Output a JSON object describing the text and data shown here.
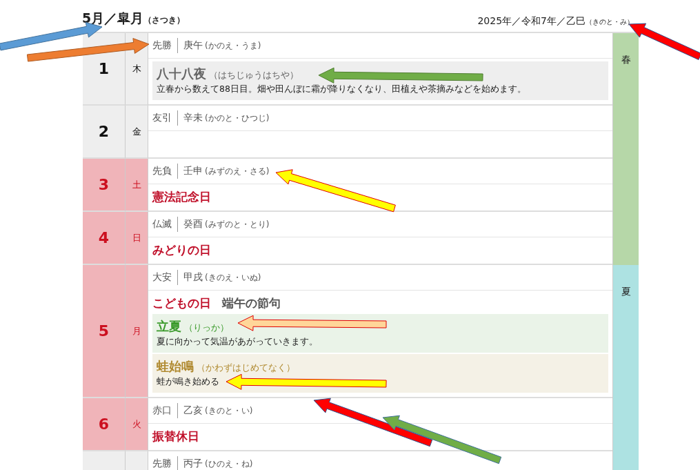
{
  "header": {
    "month": "5月／皐月",
    "month_reading": "（さつき）",
    "year": "2025年／令和7年／乙巳",
    "year_reading": "（きのと・み）"
  },
  "seasons": [
    {
      "label": "春",
      "color": "#b6d7a8",
      "days": [
        {
          "date": "1",
          "weekday": "木",
          "holiday": false,
          "rokuyo": "先勝",
          "eto": "庚午",
          "eto_reading": "(かのえ・うま)",
          "notes": [
            {
              "kind": "zassetsu",
              "title": "八十八夜",
              "reading": "（はちじゅうはちや）",
              "description": "立春から数えて88日目。畑や田んぼに霜が降りなくなり、田植えや茶摘みなどを始めます。"
            }
          ]
        },
        {
          "date": "2",
          "weekday": "金",
          "holiday": false,
          "rokuyo": "友引",
          "eto": "辛未",
          "eto_reading": "(かのと・ひつじ)"
        },
        {
          "date": "3",
          "weekday": "土",
          "holiday": true,
          "rokuyo": "先負",
          "eto": "壬申",
          "eto_reading": "(みずのえ・さる)",
          "events": [
            {
              "kind": "holiday",
              "label": "憲法記念日"
            }
          ]
        },
        {
          "date": "4",
          "weekday": "日",
          "holiday": true,
          "rokuyo": "仏滅",
          "eto": "癸酉",
          "eto_reading": "(みずのと・とり)",
          "events": [
            {
              "kind": "holiday",
              "label": "みどりの日"
            }
          ]
        }
      ]
    },
    {
      "label": "夏",
      "color": "#ade2e2",
      "days": [
        {
          "date": "5",
          "weekday": "月",
          "holiday": true,
          "rokuyo": "大安",
          "eto": "甲戌",
          "eto_reading": "(きのえ・いぬ)",
          "events": [
            {
              "kind": "holiday",
              "label": "こどもの日"
            },
            {
              "kind": "sekku",
              "label": "端午の節句"
            }
          ],
          "notes": [
            {
              "kind": "sekki",
              "title": "立夏",
              "reading": "（りっか）",
              "description": "夏に向かって気温があがっていきます。"
            },
            {
              "kind": "kou",
              "title": "蛙始鳴",
              "reading": "（かわずはじめてなく）",
              "description": "蛙が鳴き始める"
            }
          ]
        },
        {
          "date": "6",
          "weekday": "火",
          "holiday": true,
          "rokuyo": "赤口",
          "eto": "乙亥",
          "eto_reading": "(きのと・い)",
          "events": [
            {
              "kind": "holiday",
              "label": "振替休日"
            }
          ]
        },
        {
          "holiday": false,
          "rokuyo": "先勝",
          "eto": "丙子",
          "eto_reading": "(ひのえ・ね)"
        }
      ]
    }
  ]
}
